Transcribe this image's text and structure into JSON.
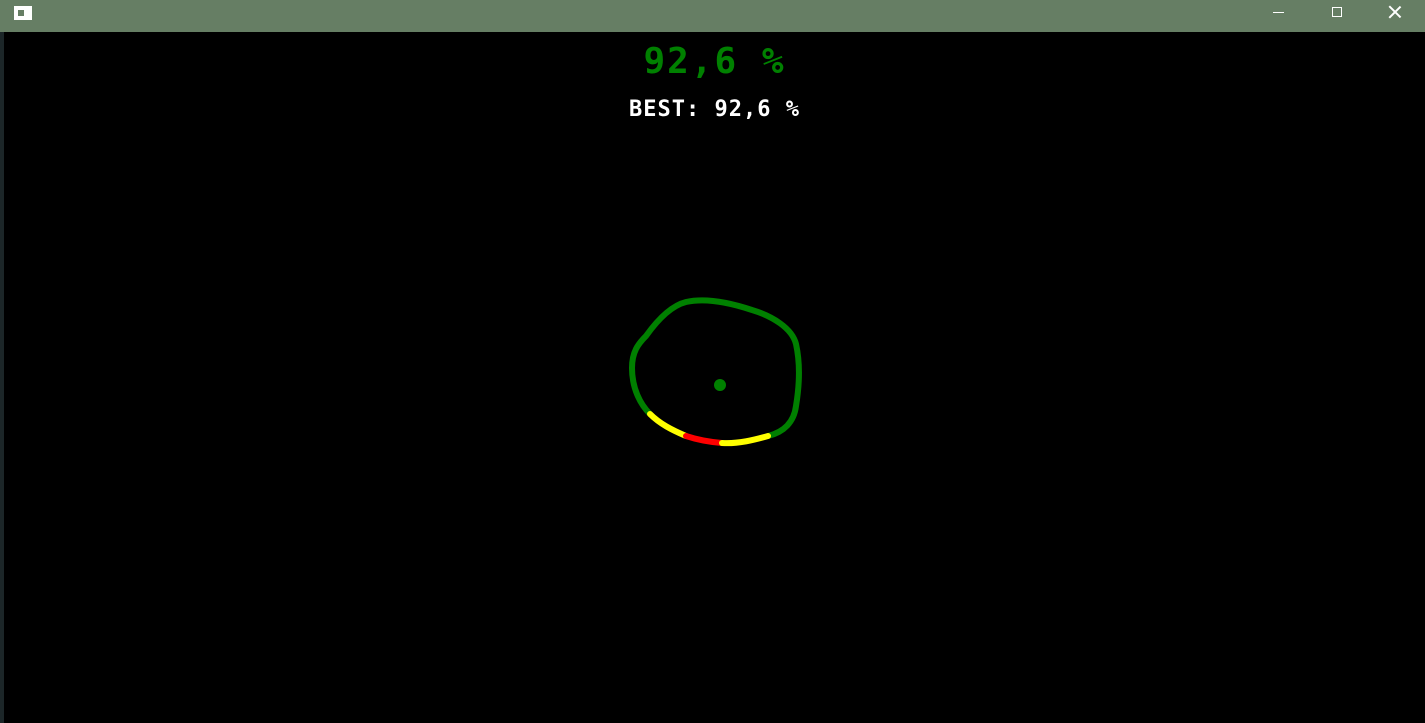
{
  "game": {
    "score_text": "92,6 %",
    "best_label": "BEST:",
    "best_value": "92,6 %",
    "score_percent": 92.6,
    "best_percent": 92.6
  },
  "colors": {
    "titlebar": "#667e64",
    "background": "#000000",
    "score": "#008000",
    "stroke_good": "#008000",
    "stroke_ok": "#ffff00",
    "stroke_bad": "#ff0000",
    "best_text": "#ffffff"
  },
  "icons": {
    "app": "app-window-icon",
    "minimize": "minimize-icon",
    "maximize": "maximize-icon",
    "close": "close-icon"
  }
}
